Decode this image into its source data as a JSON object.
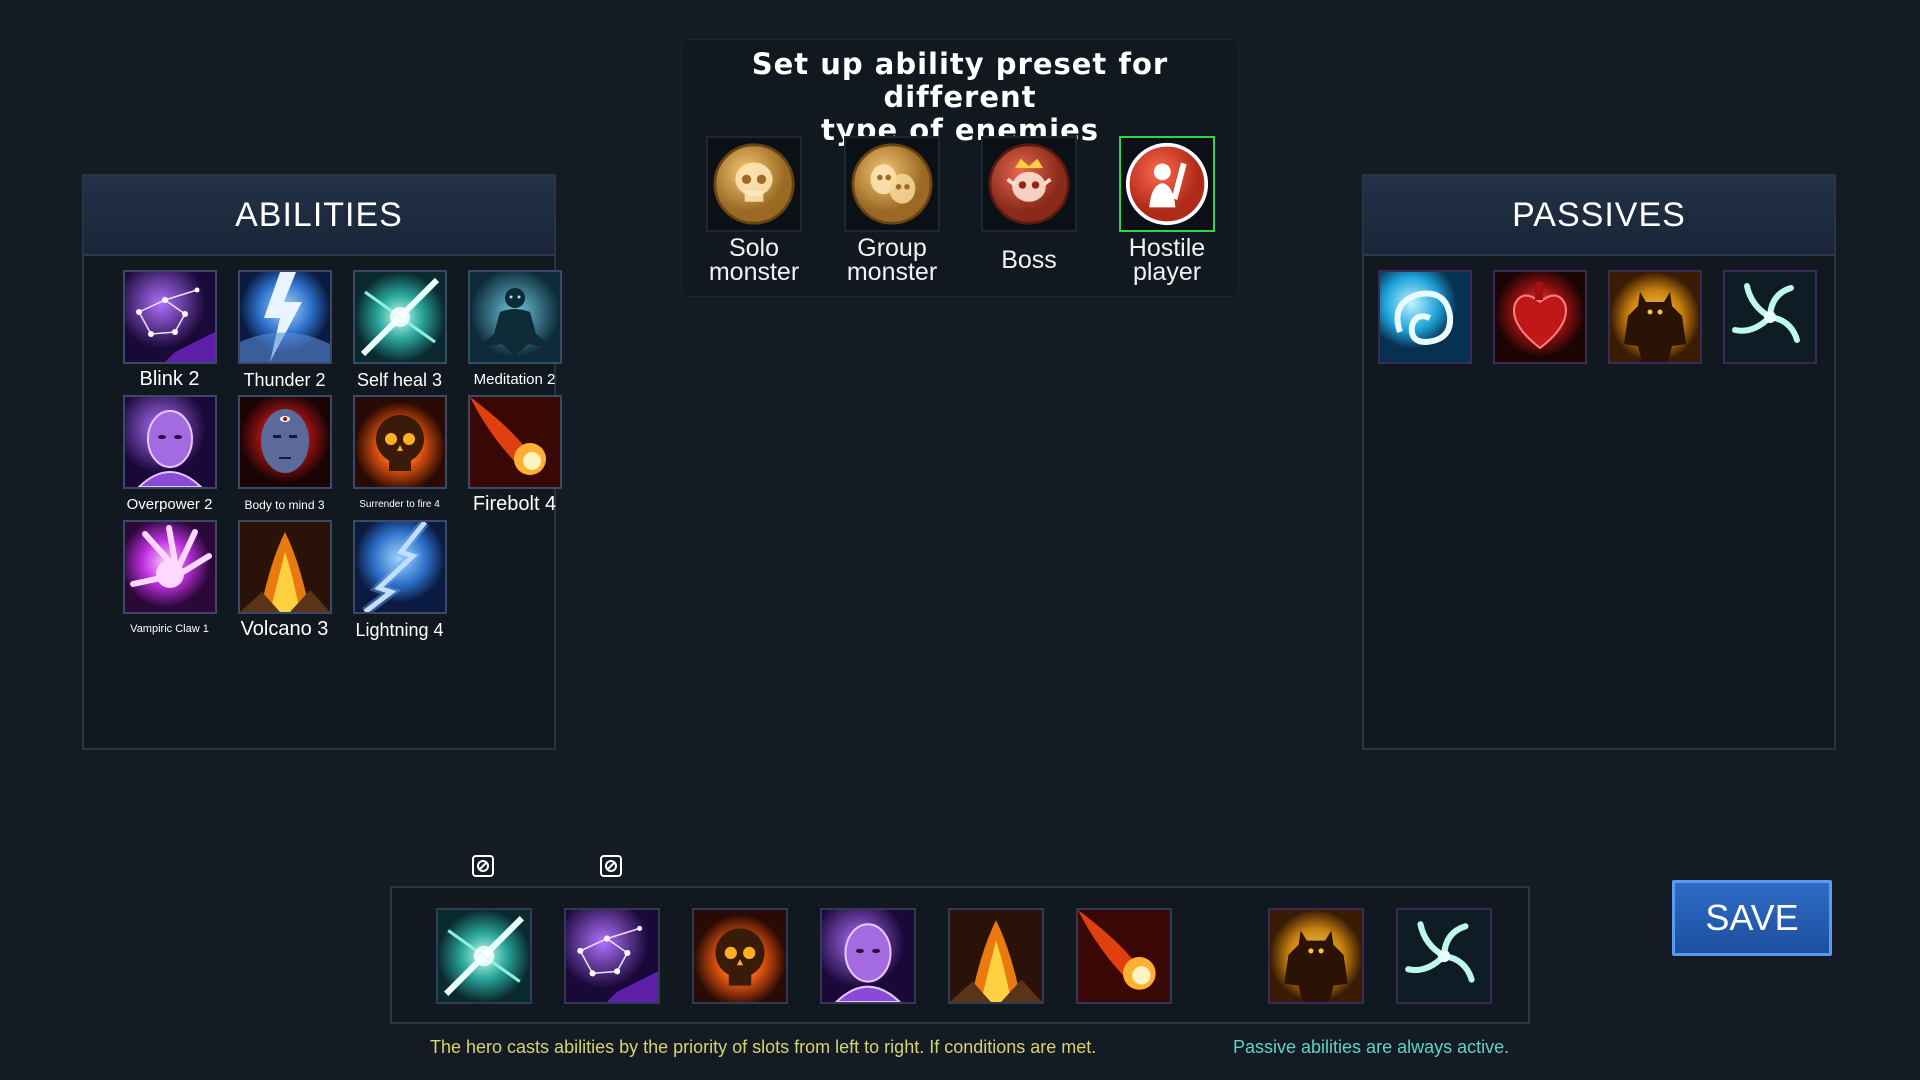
{
  "preset_panel": {
    "title_line1": "Set up ability preset for different",
    "title_line2": "type of enemies",
    "presets": [
      {
        "label_line1": "Solo",
        "label_line2": "monster",
        "icon": "skull-medallion-icon"
      },
      {
        "label_line1": "Group",
        "label_line2": "monster",
        "icon": "two-masks-medallion-icon"
      },
      {
        "label_line1": "Boss",
        "label_line2": "",
        "icon": "crowned-skull-medallion-icon"
      },
      {
        "label_line1": "Hostile",
        "label_line2": "player",
        "icon": "knight-medallion-icon",
        "selected": true
      }
    ]
  },
  "abilities_panel": {
    "title": "ABILITIES",
    "items": [
      {
        "label": "Blink 2",
        "icon": "constellation-icon"
      },
      {
        "label": "Thunder 2",
        "icon": "thunder-icon"
      },
      {
        "label": "Self heal 3",
        "icon": "cross-slash-icon"
      },
      {
        "label": "Meditation 2",
        "icon": "meditation-figure-icon"
      },
      {
        "label": "Overpower 2",
        "icon": "purple-head-icon"
      },
      {
        "label": "Body to mind 3",
        "icon": "third-eye-head-icon"
      },
      {
        "label": "Surrender to fire 4",
        "icon": "flaming-skull-icon"
      },
      {
        "label": "Firebolt 4",
        "icon": "fireball-icon"
      },
      {
        "label": "Vampiric Claw 1",
        "icon": "claw-hand-icon"
      },
      {
        "label": "Volcano 3",
        "icon": "volcano-fire-icon"
      },
      {
        "label": "Lightning 4",
        "icon": "lightning-icon"
      }
    ]
  },
  "passives_panel": {
    "title": "PASSIVES",
    "items": [
      {
        "icon": "water-swirl-icon"
      },
      {
        "icon": "heart-icon"
      },
      {
        "icon": "golem-silhouette-icon"
      },
      {
        "icon": "whirlwind-icon"
      }
    ]
  },
  "slot_bar": {
    "active_slots": [
      "cross-slash-icon",
      "constellation-icon",
      "flaming-skull-icon",
      "purple-head-icon",
      "volcano-fire-icon",
      "fireball-icon"
    ],
    "passive_slots": [
      "golem-silhouette-icon",
      "whirlwind-icon"
    ],
    "condition_icons": [
      "condition-gear-icon",
      "condition-gear-icon"
    ]
  },
  "hints": {
    "priority": "The hero casts abilities by the priority of slots from left to right. If conditions are met.",
    "passive": "Passive abilities are always active."
  },
  "save_button": {
    "label": "SAVE"
  },
  "colors": {
    "background": "#151b24",
    "selected_border": "#2bd64a",
    "hint_priority": "#d6d46a",
    "hint_passive": "#5ad6c8",
    "save_button": "#2e6cc7"
  }
}
